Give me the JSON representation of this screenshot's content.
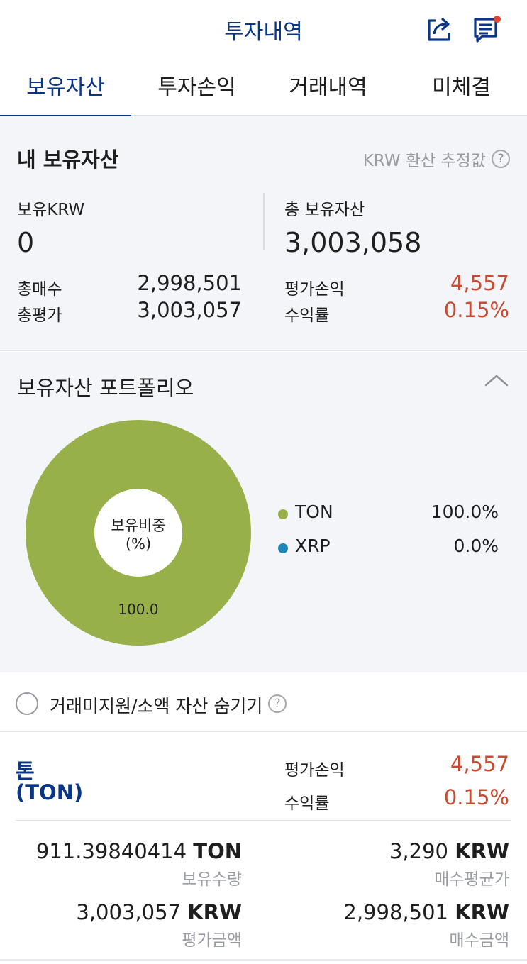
{
  "header": {
    "title": "투자내역",
    "share_icon": "share-icon",
    "notice_icon": "notice-icon",
    "badge_color": "#e0442c"
  },
  "tabs": [
    {
      "label": "보유자산",
      "active": true
    },
    {
      "label": "투자손익",
      "active": false
    },
    {
      "label": "거래내역",
      "active": false
    },
    {
      "label": "미체결",
      "active": false
    }
  ],
  "summary": {
    "title": "내 보유자산",
    "hint": "KRW 환산 추정값",
    "krw_label": "보유KRW",
    "krw_value": "0",
    "total_label": "총 보유자산",
    "total_value": "3,003,058",
    "buy_total_label": "총매수",
    "buy_total_value": "2,998,501",
    "eval_total_label": "총평가",
    "eval_total_value": "3,003,057",
    "pnl_label": "평가손익",
    "pnl_value": "4,557",
    "rate_label": "수익률",
    "rate_value": "0.15%"
  },
  "portfolio": {
    "title": "보유자산 포트폴리오",
    "center_label_line1": "보유비중",
    "center_label_line2": "(%)",
    "slice_label": "100.0",
    "legend": [
      {
        "name": "TON",
        "pct": "100.0%",
        "color": "#97b04a"
      },
      {
        "name": "XRP",
        "pct": "0.0%",
        "color": "#1e88b8"
      }
    ]
  },
  "chart_data": {
    "type": "pie",
    "categories": [
      "TON",
      "XRP"
    ],
    "values": [
      100.0,
      0.0
    ],
    "title": "",
    "donut": true
  },
  "hide_small": {
    "label": "거래미지원/소액 자산 숨기기",
    "checked": false
  },
  "asset": {
    "name_ko": "톤",
    "name_code": "(TON)",
    "pnl_label": "평가손익",
    "pnl_value": "4,557",
    "rate_label": "수익률",
    "rate_value": "0.15%",
    "quantity": "911.39840414",
    "quantity_unit": "TON",
    "quantity_label": "보유수량",
    "avg_price": "3,290",
    "avg_price_unit": "KRW",
    "avg_price_label": "매수평균가",
    "eval_amount": "3,003,057",
    "eval_amount_unit": "KRW",
    "eval_amount_label": "평가금액",
    "buy_amount": "2,998,501",
    "buy_amount_unit": "KRW",
    "buy_amount_label": "매수금액"
  },
  "colors": {
    "primary": "#093687",
    "profit": "#c84a31",
    "ton": "#97b04a",
    "xrp": "#1e88b8"
  }
}
